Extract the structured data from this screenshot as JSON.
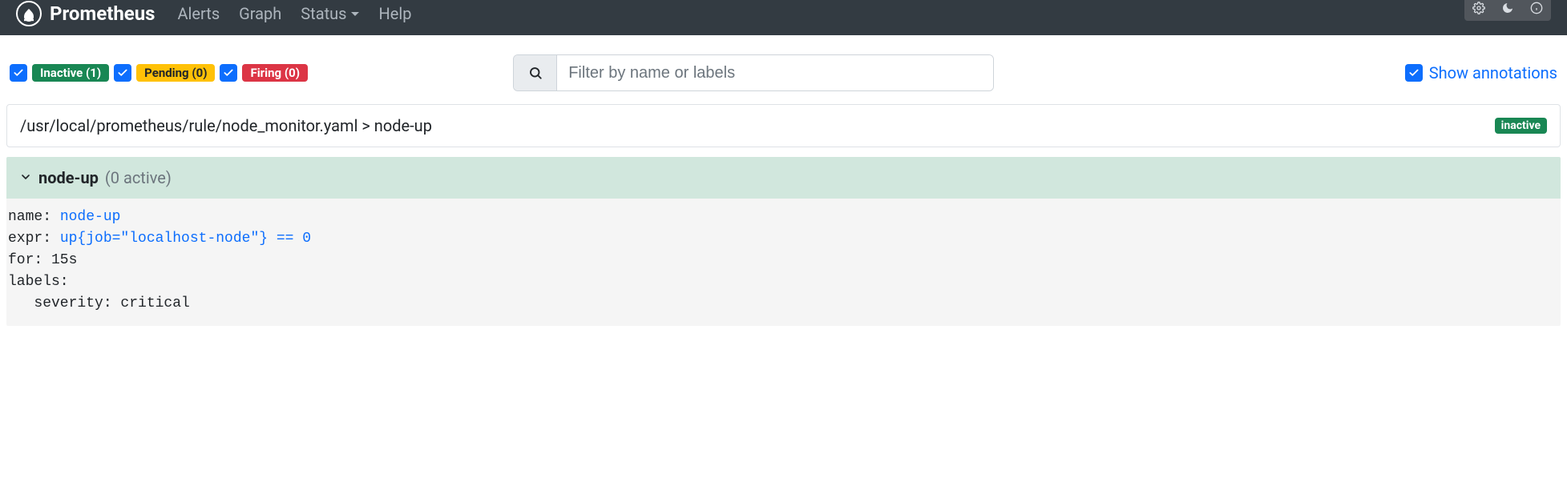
{
  "nav": {
    "brand": "Prometheus",
    "links": [
      "Alerts",
      "Graph",
      "Status",
      "Help"
    ],
    "status_has_dropdown": true
  },
  "filters": {
    "inactive_label": "Inactive (1)",
    "pending_label": "Pending (0)",
    "firing_label": "Firing (0)"
  },
  "search": {
    "placeholder": "Filter by name or labels",
    "value": ""
  },
  "show_annotations": {
    "label": "Show annotations",
    "checked": true
  },
  "rule_file": {
    "path": "/usr/local/prometheus/rule/node_monitor.yaml > node-up",
    "status": "inactive"
  },
  "group": {
    "name": "node-up",
    "active_text": "(0 active)"
  },
  "rule": {
    "name_line": "name: ",
    "name_value": "node-up",
    "expr_line": "expr: ",
    "expr_value": "up{job=\"localhost-node\"} == 0",
    "for_line": "for: 15s",
    "labels_line": "labels:",
    "severity_line": "   severity: critical"
  },
  "icons": {
    "gear": "gear-icon",
    "moon": "moon-icon",
    "info": "info-icon",
    "search": "search-icon",
    "chev": "chevron-down-icon"
  }
}
